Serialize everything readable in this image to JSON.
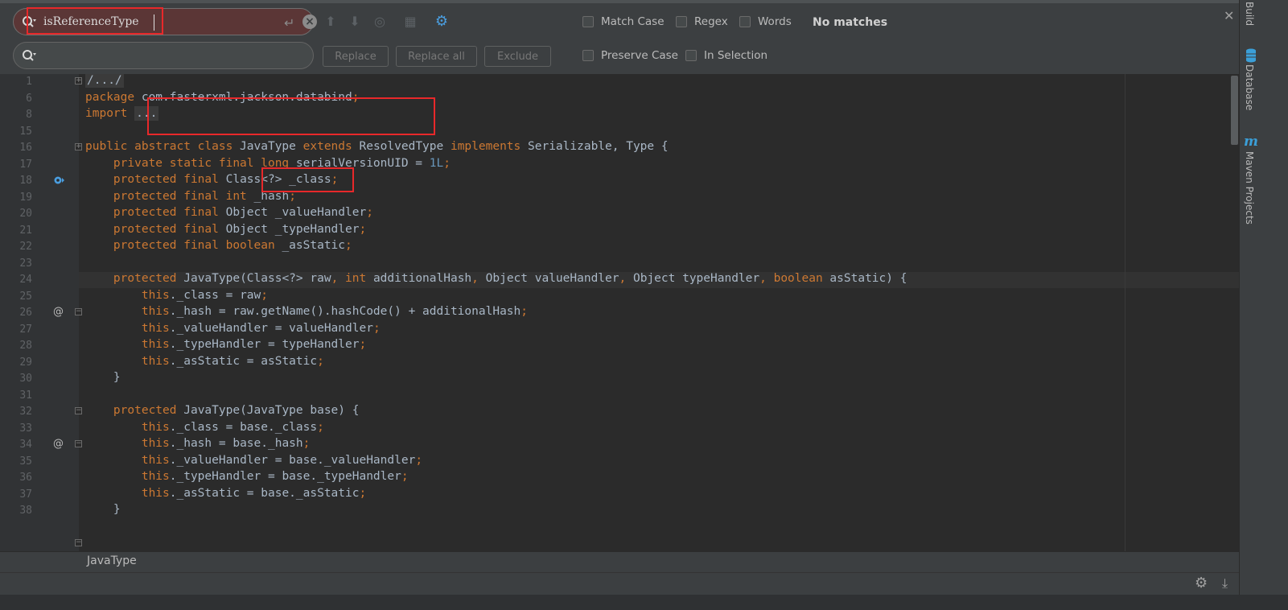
{
  "find": {
    "query": "isReferenceType",
    "status": "No matches",
    "buttons": {
      "replace": "Replace",
      "replace_all": "Replace all",
      "exclude": "Exclude"
    },
    "options": {
      "match_case": "Match Case",
      "regex": "Regex",
      "words": "Words",
      "preserve_case": "Preserve Case",
      "in_selection": "In Selection"
    }
  },
  "editor": {
    "lines": [
      {
        "n": "1",
        "html": "<span class=\"fold-bg\">/.../</span>"
      },
      {
        "n": "6",
        "html": "<span class=\"kw\">package</span> com.fasterxml.jackson.databind<span class=\"kw\">;</span>"
      },
      {
        "n": "8",
        "html": "<span class=\"kw\">import</span> <span class=\"fold-bg\">...</span>"
      },
      {
        "n": "15",
        "html": ""
      },
      {
        "n": "16",
        "html": "<span class=\"kw\">public abstract class</span> JavaType <span class=\"kw\">extends</span> ResolvedType <span class=\"kw\">implements</span> Serializable, Type {"
      },
      {
        "n": "17",
        "html": "    <span class=\"kw\">private static final long</span> serialVersionUID = <span class=\"num\">1L</span><span class=\"kw\">;</span>"
      },
      {
        "n": "18",
        "html": "    <span class=\"kw\">protected final</span> Class&lt;?&gt; _class<span class=\"kw\">;</span>"
      },
      {
        "n": "19",
        "html": "    <span class=\"kw\">protected final int</span> _hash<span class=\"kw\">;</span>"
      },
      {
        "n": "20",
        "html": "    <span class=\"kw\">protected final</span> Object _valueHandler<span class=\"kw\">;</span>"
      },
      {
        "n": "21",
        "html": "    <span class=\"kw\">protected final</span> Object _typeHandler<span class=\"kw\">;</span>"
      },
      {
        "n": "22",
        "html": "    <span class=\"kw\">protected final boolean</span> _asStatic<span class=\"kw\">;</span>"
      },
      {
        "n": "23",
        "html": ""
      },
      {
        "n": "24",
        "html": "    <span class=\"kw\">protected</span> JavaType(Class&lt;?&gt; raw<span class=\"kw\">, int</span> additionalHash<span class=\"kw\">,</span> Object valueHandler<span class=\"kw\">,</span> Object typeHandler<span class=\"kw\">, boolean</span> asStatic) {"
      },
      {
        "n": "25",
        "html": "        <span class=\"kw\">this</span>._class = raw<span class=\"kw\">;</span>"
      },
      {
        "n": "26",
        "html": "        <span class=\"kw\">this</span>._hash = raw.getName().hashCode() + additionalHash<span class=\"kw\">;</span>"
      },
      {
        "n": "27",
        "html": "        <span class=\"kw\">this</span>._valueHandler = valueHandler<span class=\"kw\">;</span>"
      },
      {
        "n": "28",
        "html": "        <span class=\"kw\">this</span>._typeHandler = typeHandler<span class=\"kw\">;</span>"
      },
      {
        "n": "29",
        "html": "        <span class=\"kw\">this</span>._asStatic = asStatic<span class=\"kw\">;</span>"
      },
      {
        "n": "30",
        "html": "    }"
      },
      {
        "n": "31",
        "html": ""
      },
      {
        "n": "32",
        "html": "    <span class=\"kw\">protected</span> JavaType(JavaType base) {"
      },
      {
        "n": "33",
        "html": "        <span class=\"kw\">this</span>._class = base._class<span class=\"kw\">;</span>"
      },
      {
        "n": "34",
        "html": "        <span class=\"kw\">this</span>._hash = base._hash<span class=\"kw\">;</span>"
      },
      {
        "n": "35",
        "html": "        <span class=\"kw\">this</span>._valueHandler = base._valueHandler<span class=\"kw\">;</span>"
      },
      {
        "n": "36",
        "html": "        <span class=\"kw\">this</span>._typeHandler = base._typeHandler<span class=\"kw\">;</span>"
      },
      {
        "n": "37",
        "html": "        <span class=\"kw\">this</span>._asStatic = base._asStatic<span class=\"kw\">;</span>"
      },
      {
        "n": "38",
        "html": "    }"
      }
    ]
  },
  "breadcrumb": "JavaType",
  "toolwindows": {
    "build": "Build",
    "database": "Database",
    "maven": "Maven Projects"
  },
  "colors": {
    "keyword": "#cc7832",
    "number": "#6897bb",
    "text": "#a9b7c6",
    "highlight_box": "#e8282a",
    "search_bg_nomatch": "#5b3636"
  }
}
